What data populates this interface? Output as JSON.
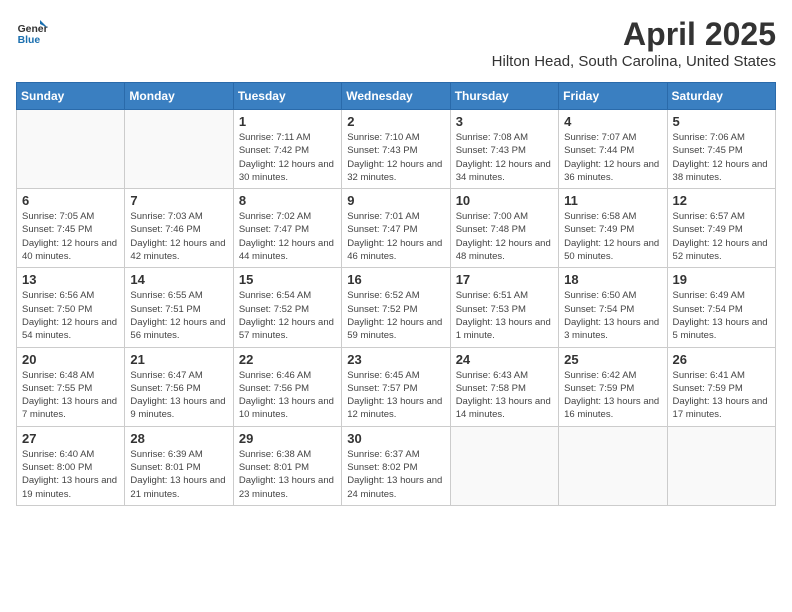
{
  "logo": {
    "general": "General",
    "blue": "Blue"
  },
  "title": "April 2025",
  "location": "Hilton Head, South Carolina, United States",
  "days_of_week": [
    "Sunday",
    "Monday",
    "Tuesday",
    "Wednesday",
    "Thursday",
    "Friday",
    "Saturday"
  ],
  "weeks": [
    [
      {
        "day": "",
        "info": ""
      },
      {
        "day": "",
        "info": ""
      },
      {
        "day": "1",
        "info": "Sunrise: 7:11 AM\nSunset: 7:42 PM\nDaylight: 12 hours and 30 minutes."
      },
      {
        "day": "2",
        "info": "Sunrise: 7:10 AM\nSunset: 7:43 PM\nDaylight: 12 hours and 32 minutes."
      },
      {
        "day": "3",
        "info": "Sunrise: 7:08 AM\nSunset: 7:43 PM\nDaylight: 12 hours and 34 minutes."
      },
      {
        "day": "4",
        "info": "Sunrise: 7:07 AM\nSunset: 7:44 PM\nDaylight: 12 hours and 36 minutes."
      },
      {
        "day": "5",
        "info": "Sunrise: 7:06 AM\nSunset: 7:45 PM\nDaylight: 12 hours and 38 minutes."
      }
    ],
    [
      {
        "day": "6",
        "info": "Sunrise: 7:05 AM\nSunset: 7:45 PM\nDaylight: 12 hours and 40 minutes."
      },
      {
        "day": "7",
        "info": "Sunrise: 7:03 AM\nSunset: 7:46 PM\nDaylight: 12 hours and 42 minutes."
      },
      {
        "day": "8",
        "info": "Sunrise: 7:02 AM\nSunset: 7:47 PM\nDaylight: 12 hours and 44 minutes."
      },
      {
        "day": "9",
        "info": "Sunrise: 7:01 AM\nSunset: 7:47 PM\nDaylight: 12 hours and 46 minutes."
      },
      {
        "day": "10",
        "info": "Sunrise: 7:00 AM\nSunset: 7:48 PM\nDaylight: 12 hours and 48 minutes."
      },
      {
        "day": "11",
        "info": "Sunrise: 6:58 AM\nSunset: 7:49 PM\nDaylight: 12 hours and 50 minutes."
      },
      {
        "day": "12",
        "info": "Sunrise: 6:57 AM\nSunset: 7:49 PM\nDaylight: 12 hours and 52 minutes."
      }
    ],
    [
      {
        "day": "13",
        "info": "Sunrise: 6:56 AM\nSunset: 7:50 PM\nDaylight: 12 hours and 54 minutes."
      },
      {
        "day": "14",
        "info": "Sunrise: 6:55 AM\nSunset: 7:51 PM\nDaylight: 12 hours and 56 minutes."
      },
      {
        "day": "15",
        "info": "Sunrise: 6:54 AM\nSunset: 7:52 PM\nDaylight: 12 hours and 57 minutes."
      },
      {
        "day": "16",
        "info": "Sunrise: 6:52 AM\nSunset: 7:52 PM\nDaylight: 12 hours and 59 minutes."
      },
      {
        "day": "17",
        "info": "Sunrise: 6:51 AM\nSunset: 7:53 PM\nDaylight: 13 hours and 1 minute."
      },
      {
        "day": "18",
        "info": "Sunrise: 6:50 AM\nSunset: 7:54 PM\nDaylight: 13 hours and 3 minutes."
      },
      {
        "day": "19",
        "info": "Sunrise: 6:49 AM\nSunset: 7:54 PM\nDaylight: 13 hours and 5 minutes."
      }
    ],
    [
      {
        "day": "20",
        "info": "Sunrise: 6:48 AM\nSunset: 7:55 PM\nDaylight: 13 hours and 7 minutes."
      },
      {
        "day": "21",
        "info": "Sunrise: 6:47 AM\nSunset: 7:56 PM\nDaylight: 13 hours and 9 minutes."
      },
      {
        "day": "22",
        "info": "Sunrise: 6:46 AM\nSunset: 7:56 PM\nDaylight: 13 hours and 10 minutes."
      },
      {
        "day": "23",
        "info": "Sunrise: 6:45 AM\nSunset: 7:57 PM\nDaylight: 13 hours and 12 minutes."
      },
      {
        "day": "24",
        "info": "Sunrise: 6:43 AM\nSunset: 7:58 PM\nDaylight: 13 hours and 14 minutes."
      },
      {
        "day": "25",
        "info": "Sunrise: 6:42 AM\nSunset: 7:59 PM\nDaylight: 13 hours and 16 minutes."
      },
      {
        "day": "26",
        "info": "Sunrise: 6:41 AM\nSunset: 7:59 PM\nDaylight: 13 hours and 17 minutes."
      }
    ],
    [
      {
        "day": "27",
        "info": "Sunrise: 6:40 AM\nSunset: 8:00 PM\nDaylight: 13 hours and 19 minutes."
      },
      {
        "day": "28",
        "info": "Sunrise: 6:39 AM\nSunset: 8:01 PM\nDaylight: 13 hours and 21 minutes."
      },
      {
        "day": "29",
        "info": "Sunrise: 6:38 AM\nSunset: 8:01 PM\nDaylight: 13 hours and 23 minutes."
      },
      {
        "day": "30",
        "info": "Sunrise: 6:37 AM\nSunset: 8:02 PM\nDaylight: 13 hours and 24 minutes."
      },
      {
        "day": "",
        "info": ""
      },
      {
        "day": "",
        "info": ""
      },
      {
        "day": "",
        "info": ""
      }
    ]
  ]
}
